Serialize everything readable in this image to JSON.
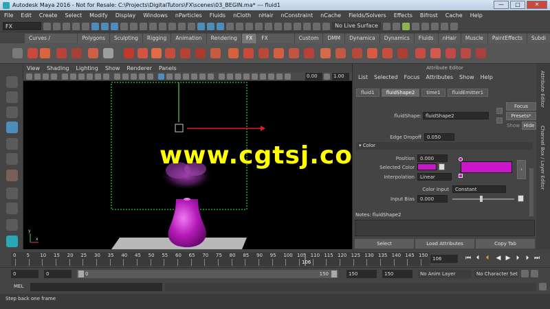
{
  "window": {
    "title": "Autodesk Maya 2016 - Not for Resale: C:\\Projects\\DigitalTutors\\FX\\scenes\\03_BEGIN.ma*  ---  fluid1"
  },
  "menubar": [
    "File",
    "Edit",
    "Create",
    "Select",
    "Modify",
    "Display",
    "Windows",
    "nParticles",
    "Fluids",
    "nCloth",
    "nHair",
    "nConstraint",
    "nCache",
    "Fields/Solvers",
    "Effects",
    "Bifrost",
    "Cache",
    "Help"
  ],
  "statusline": {
    "mode": "FX",
    "live_surface": "No Live Surface"
  },
  "shelf_tabs": [
    {
      "label": "Curves / Surfaces",
      "active": false
    },
    {
      "label": "Polygons",
      "active": false
    },
    {
      "label": "Sculpting",
      "active": false
    },
    {
      "label": "Rigging",
      "active": false
    },
    {
      "label": "Animation",
      "active": false
    },
    {
      "label": "Rendering",
      "active": false
    },
    {
      "label": "FX",
      "active": true
    },
    {
      "label": "FX Caching",
      "active": false
    },
    {
      "label": "Custom",
      "active": false
    },
    {
      "label": "DMM",
      "active": false
    },
    {
      "label": "Dynamica",
      "active": false
    },
    {
      "label": "Dynamics",
      "active": false
    },
    {
      "label": "Fluids",
      "active": false
    },
    {
      "label": "nHair",
      "active": false
    },
    {
      "label": "Muscle",
      "active": false
    },
    {
      "label": "PaintEffects",
      "active": false
    },
    {
      "label": "Subdi",
      "active": false
    }
  ],
  "viewport": {
    "menu": [
      "View",
      "Shading",
      "Lighting",
      "Show",
      "Renderer",
      "Panels"
    ],
    "field_a": "0.00",
    "field_b": "1.00",
    "watermark": "www.cgtsj.com",
    "axis_x": "x",
    "axis_y": "y"
  },
  "attribute_editor": {
    "title": "Attribute Editor",
    "menu": [
      "List",
      "Selected",
      "Focus",
      "Attributes",
      "Show",
      "Help"
    ],
    "tabs": [
      {
        "label": "fluid1",
        "active": false
      },
      {
        "label": "fluidShape2",
        "active": true
      },
      {
        "label": "time1",
        "active": false
      },
      {
        "label": "fluidEmitter1",
        "active": false
      }
    ],
    "node_label": "fluidShape:",
    "node_value": "fluidShape2",
    "focus_btn": "Focus",
    "presets_btn": "Presets*",
    "show_label": "Show",
    "hide_btn": "Hide",
    "edge_dropoff_label": "Edge Dropoff",
    "edge_dropoff_value": "0.050",
    "color_section": "Color",
    "position_label": "Position",
    "position_value": "0.000",
    "selected_color_label": "Selected Color",
    "interpolation_label": "Interpolation",
    "interpolation_value": "Linear",
    "color_input_label": "Color Input",
    "color_input_value": "Constant",
    "input_bias_label": "Input Bias",
    "input_bias_value": "0.000",
    "notes": "Notes: fluidShape2",
    "select_btn": "Select",
    "load_btn": "Load Attributes",
    "copy_btn": "Copy Tab",
    "swatch_color": "#c717c9"
  },
  "side_tabs": [
    "Attribute Editor",
    "Channel Box / Layer Editor"
  ],
  "timeline": {
    "ticks": [
      "0",
      "5",
      "10",
      "15",
      "20",
      "25",
      "30",
      "35",
      "40",
      "45",
      "50",
      "55",
      "60",
      "65",
      "70",
      "75",
      "80",
      "85",
      "90",
      "95",
      "100",
      "105",
      "110",
      "115",
      "120",
      "125",
      "130",
      "135",
      "140",
      "145",
      "150"
    ],
    "current_marker": "106",
    "current_frame": "106"
  },
  "range": {
    "start": "0",
    "start2": "0",
    "range_start_label": "0",
    "range_end_label": "150",
    "end": "150",
    "end2": "150",
    "anim_layer": "No Anim Layer",
    "char_set": "No Character Set"
  },
  "cmdline": {
    "label": "MEL"
  },
  "helpline": {
    "text": "Step back one frame"
  }
}
